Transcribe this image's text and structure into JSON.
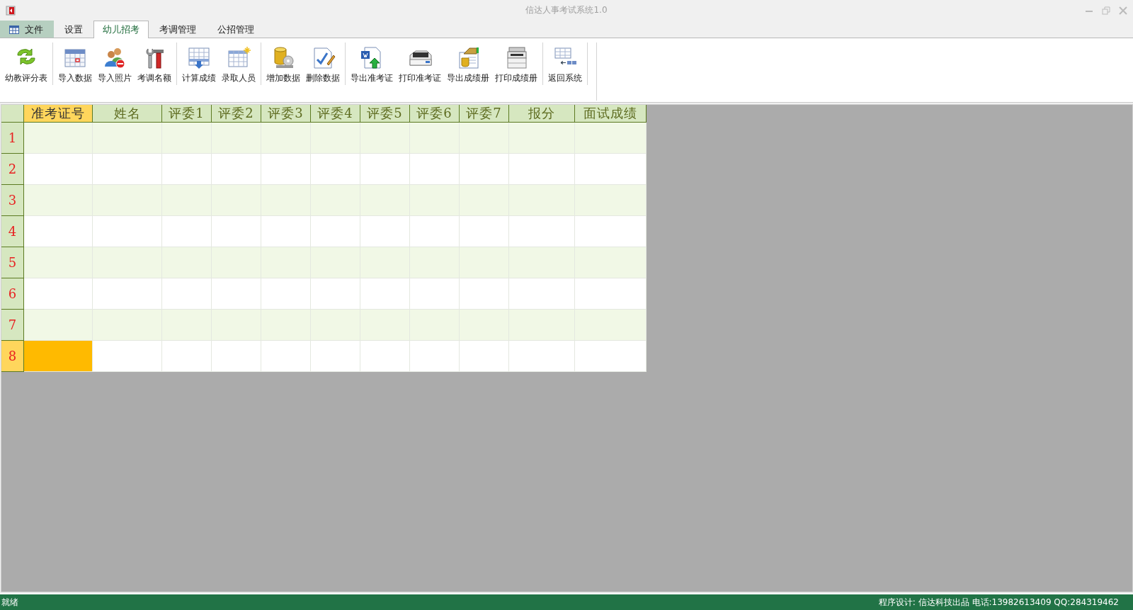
{
  "window": {
    "title": "信达人事考试系统1.0"
  },
  "tabs": [
    {
      "label": "文件",
      "kind": "file",
      "selected": false
    },
    {
      "label": "设置",
      "kind": "normal",
      "selected": false
    },
    {
      "label": "幼儿招考",
      "kind": "normal",
      "selected": true
    },
    {
      "label": "考调管理",
      "kind": "normal",
      "selected": false
    },
    {
      "label": "公招管理",
      "kind": "normal",
      "selected": false
    }
  ],
  "toolbar": {
    "groups": [
      [
        {
          "label": "幼教评分表"
        }
      ],
      [
        {
          "label": "导入数据"
        },
        {
          "label": "导入照片"
        },
        {
          "label": "考调名额"
        }
      ],
      [
        {
          "label": "计算成绩"
        },
        {
          "label": "录取人员"
        }
      ],
      [
        {
          "label": "增加数据"
        },
        {
          "label": "删除数据"
        }
      ],
      [
        {
          "label": "导出准考证"
        },
        {
          "label": "打印准考证"
        },
        {
          "label": "导出成绩册"
        },
        {
          "label": "打印成绩册"
        }
      ],
      [
        {
          "label": "返回系统"
        }
      ]
    ]
  },
  "table": {
    "columns": [
      {
        "label": "准考证号",
        "selected": true
      },
      {
        "label": "姓名",
        "selected": false
      },
      {
        "label": "评委1",
        "selected": false
      },
      {
        "label": "评委2",
        "selected": false
      },
      {
        "label": "评委3",
        "selected": false
      },
      {
        "label": "评委4",
        "selected": false
      },
      {
        "label": "评委5",
        "selected": false
      },
      {
        "label": "评委6",
        "selected": false
      },
      {
        "label": "评委7",
        "selected": false
      },
      {
        "label": "报分",
        "selected": false
      },
      {
        "label": "面试成绩",
        "selected": false
      }
    ],
    "rows": [
      {
        "label": "1",
        "selected": false
      },
      {
        "label": "2",
        "selected": false
      },
      {
        "label": "3",
        "selected": false
      },
      {
        "label": "4",
        "selected": false
      },
      {
        "label": "5",
        "selected": false
      },
      {
        "label": "6",
        "selected": false
      },
      {
        "label": "7",
        "selected": false
      },
      {
        "label": "8",
        "selected": true
      }
    ]
  },
  "status_bar": {
    "left": "就绪",
    "right": "程序设计: 信达科技出品 电话:13982613409 QQ:284319462"
  }
}
